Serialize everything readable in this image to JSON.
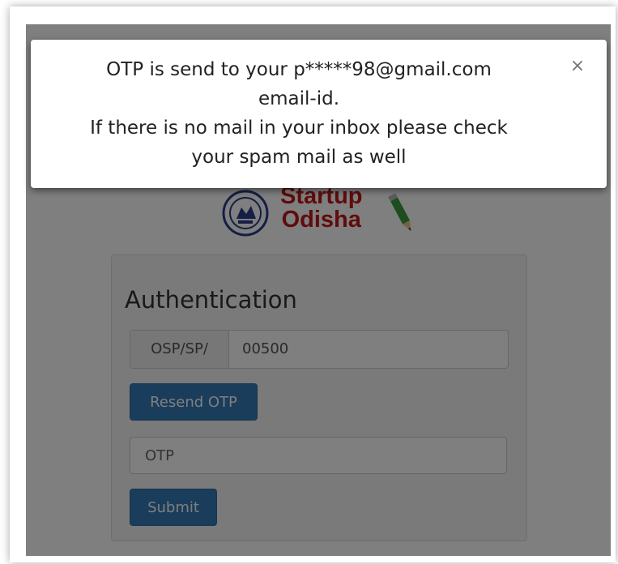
{
  "modal": {
    "line1": "OTP is send to your p*****98@gmail.com",
    "line2": "email-id.",
    "line3": "If there is no mail in your inbox please check",
    "line4": "your spam mail as well",
    "close_icon": "close-icon",
    "close_glyph": "×"
  },
  "logo": {
    "line1": "Startup",
    "line2": "Odisha",
    "seal_icon": "odisha-seal-icon",
    "pencil_icon": "pencil-icon"
  },
  "form": {
    "title": "Authentication",
    "prefix": "OSP/SP/",
    "id_value": "00500",
    "resend_label": "Resend OTP",
    "otp_placeholder": "OTP",
    "submit_label": "Submit"
  },
  "colors": {
    "brand_red": "#c01818",
    "button_blue": "#337ab7"
  }
}
